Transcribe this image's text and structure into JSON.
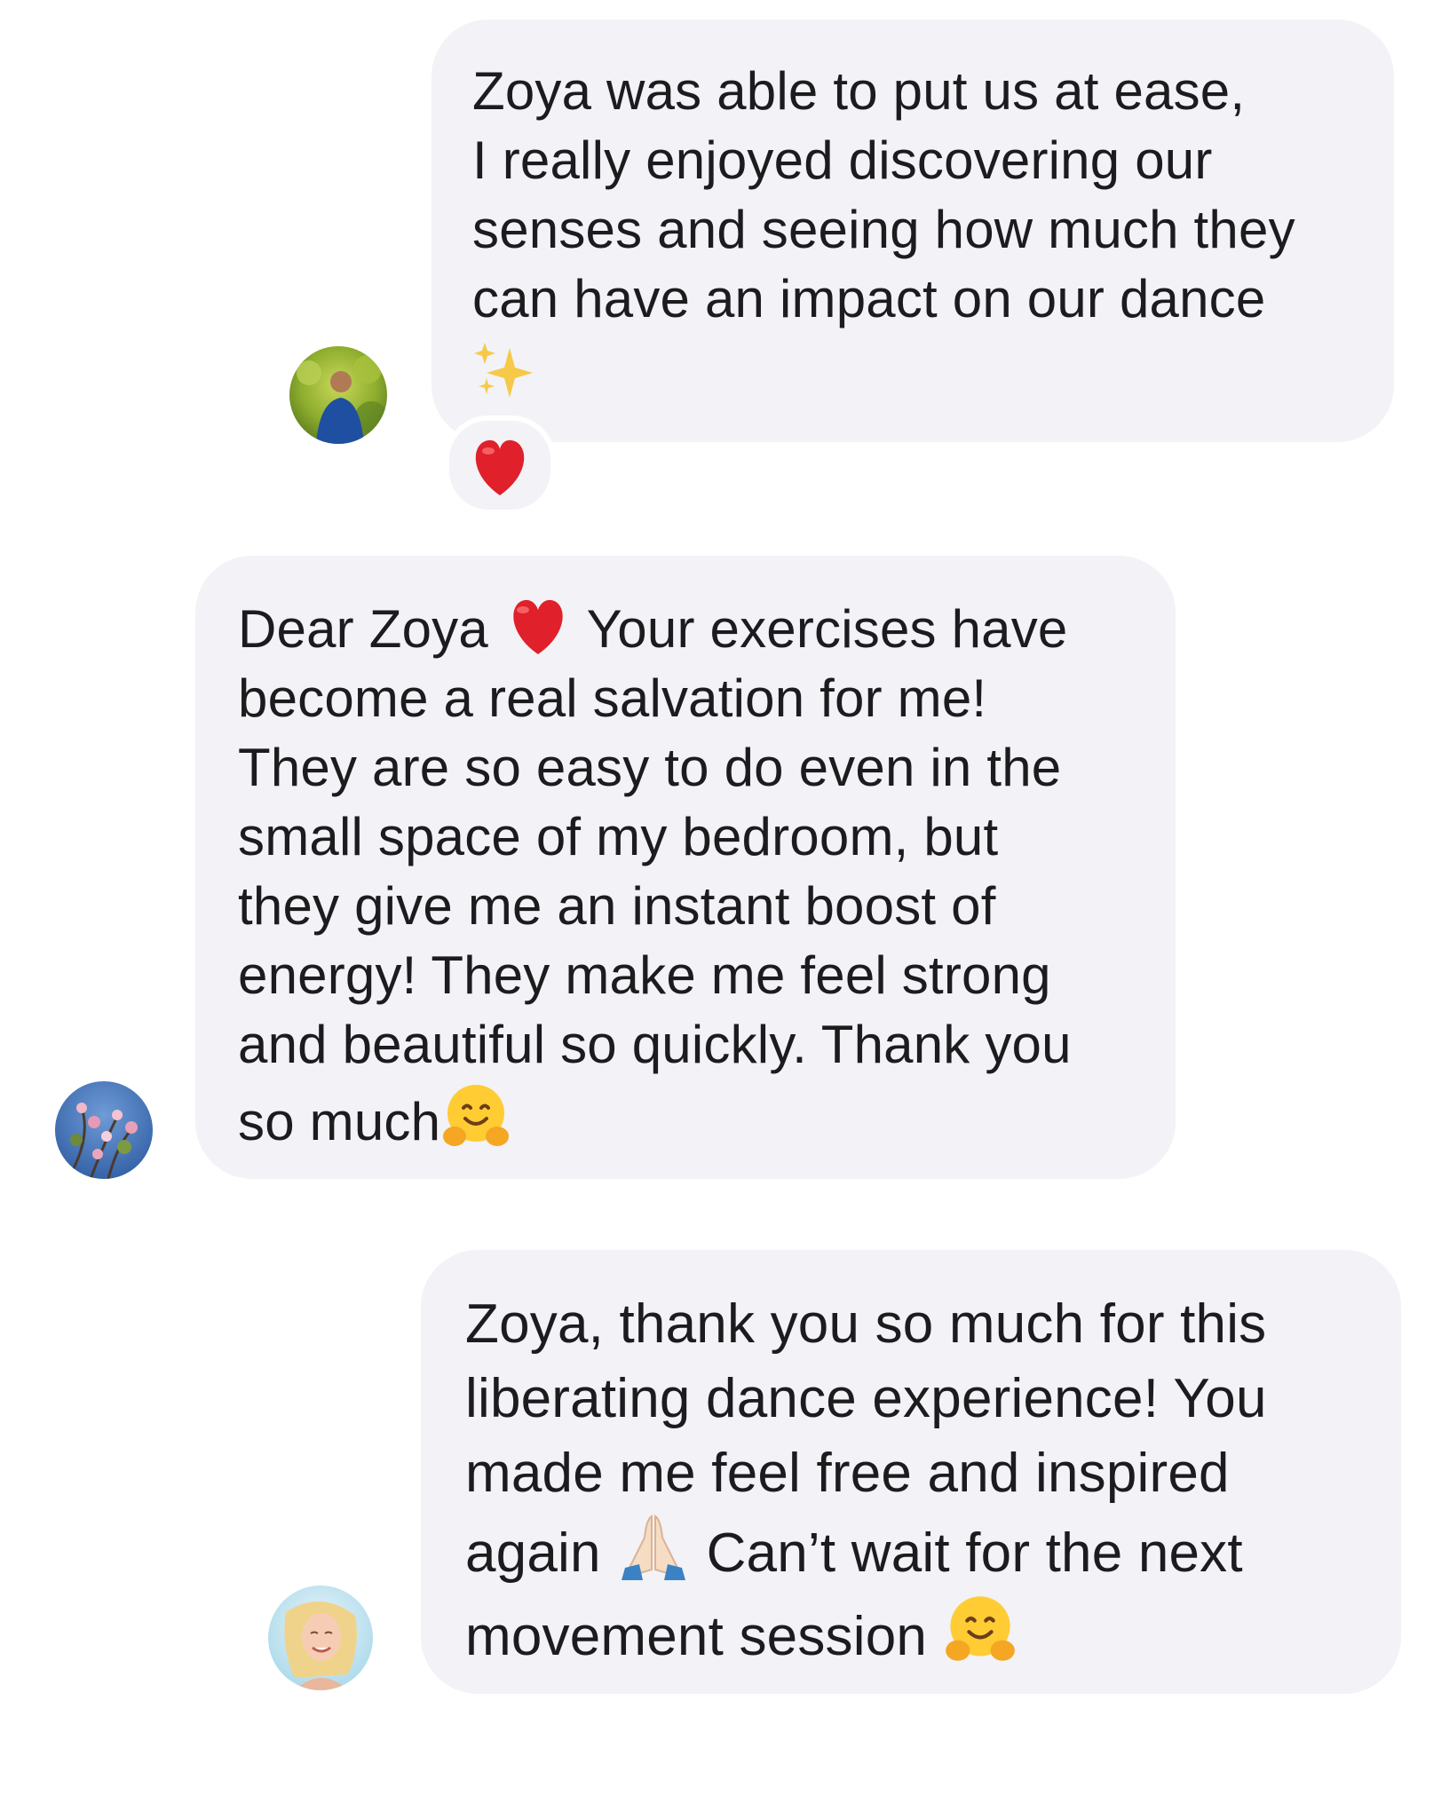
{
  "messages": [
    {
      "lines": [
        "Zoya was able to put us at ease,",
        "I really enjoyed discovering our",
        "senses and seeing how much they",
        "can have an impact on our dance"
      ],
      "trailing_emoji": "sparkles-icon",
      "reaction": "red-heart-icon"
    },
    {
      "line1_before": "Dear Zoya",
      "line1_emoji": "red-heart-icon",
      "line1_after": "Your exercises have",
      "lines": [
        "become a real salvation for me!",
        "They are so easy to do even in the",
        "small space of my bedroom, but",
        "they give me an instant boost of",
        "energy! They make me feel strong",
        "and beautiful so quickly. Thank you"
      ],
      "last_line": "so much",
      "last_emoji": "hugging-face-icon"
    },
    {
      "lines": [
        "Zoya, thank you so much for this",
        "liberating dance experience! You",
        "made me feel free and inspired"
      ],
      "line4_before": "again",
      "line4_emoji": "folded-hands-icon",
      "line4_after": "Can’t wait for the next",
      "last_line": "movement session",
      "last_emoji": "hugging-face-icon"
    }
  ],
  "colors": {
    "bubble": "#f2f2f7",
    "text": "#1c1c1e",
    "background": "#ffffff"
  }
}
